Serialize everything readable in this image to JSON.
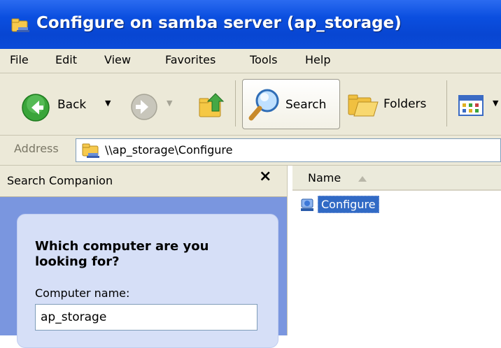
{
  "window": {
    "title": "Configure on samba server (ap_storage)"
  },
  "menu": [
    "File",
    "Edit",
    "View",
    "Favorites",
    "Tools",
    "Help"
  ],
  "toolbar": {
    "back_label": "Back",
    "search_label": "Search",
    "folders_label": "Folders",
    "icons": [
      "back-arrow-icon",
      "forward-arrow-icon",
      "up-folder-icon",
      "search-magnifier-icon",
      "folders-icon",
      "views-icon"
    ]
  },
  "address": {
    "label": "Address",
    "path": "\\\\ap_storage\\Configure"
  },
  "search_pane": {
    "title": "Search Companion",
    "close_glyph": "×",
    "question": "Which computer are you looking for?",
    "field_label": "Computer name:",
    "field_value": "ap_storage"
  },
  "file_list": {
    "column_header": "Name",
    "items": [
      {
        "name": "Configure",
        "icon": "network-share-icon",
        "selected": true
      }
    ]
  },
  "colors": {
    "titlebar": "#0846d2",
    "chrome": "#ece9d8",
    "pane_blue": "#7a96df",
    "selection": "#316ac5"
  }
}
